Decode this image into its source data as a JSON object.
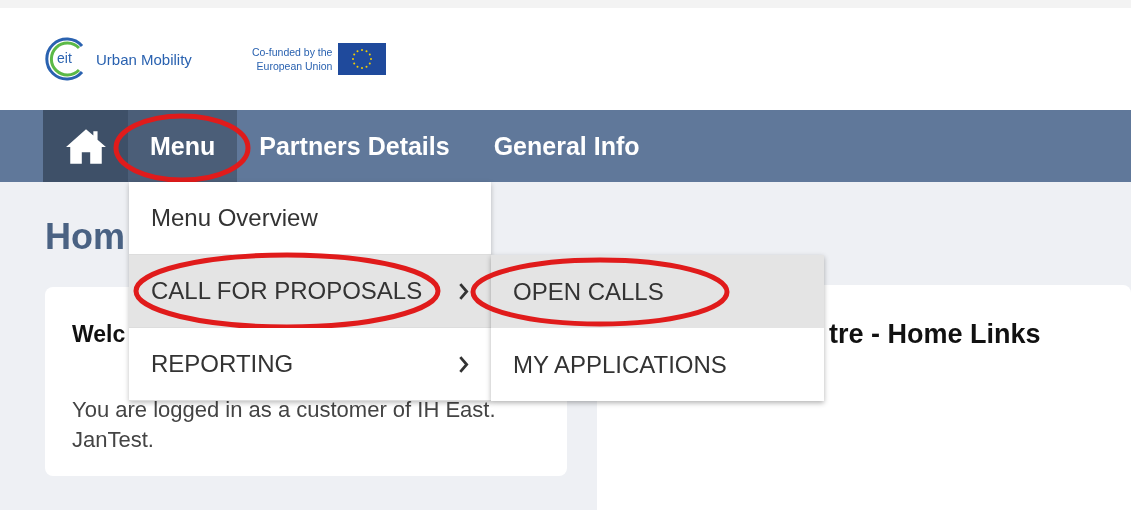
{
  "logo": {
    "mark": "eit",
    "name": "Urban Mobility"
  },
  "funding": {
    "lines": [
      "Co-funded by the",
      "European Union"
    ]
  },
  "nav": [
    {
      "label": "Menu",
      "selected": true,
      "annotated": true
    },
    {
      "label": "Partners Details",
      "selected": false,
      "annotated": false
    },
    {
      "label": "General Info",
      "selected": false,
      "annotated": false
    }
  ],
  "page_heading": "Hom",
  "dropdown": [
    {
      "label": "Menu Overview",
      "has_submenu": false,
      "selected": false,
      "annotated": false
    },
    {
      "label": "CALL FOR PROPOSALS",
      "has_submenu": true,
      "selected": true,
      "annotated": true
    },
    {
      "label": "REPORTING",
      "has_submenu": true,
      "selected": false,
      "annotated": false
    }
  ],
  "submenu": [
    {
      "label": "OPEN CALLS",
      "selected": true,
      "annotated": true
    },
    {
      "label": "MY APPLICATIONS",
      "selected": false,
      "annotated": false
    }
  ],
  "welcome_card": {
    "title": "Welc",
    "text": "You are logged in as a customer of IH East. JanTest."
  },
  "links_card": {
    "title": "tre - Home Links"
  }
}
